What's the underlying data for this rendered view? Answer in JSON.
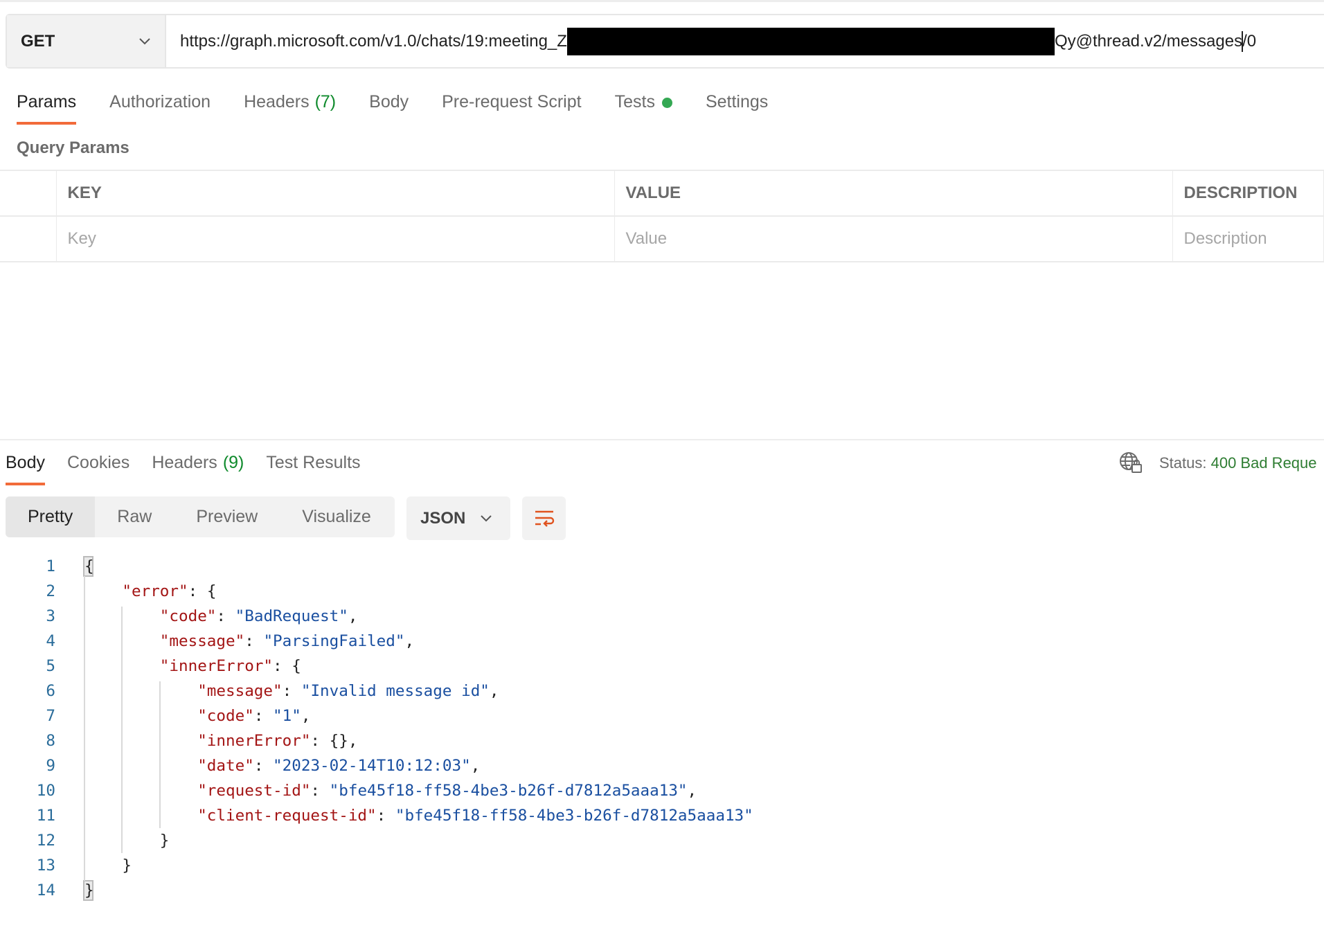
{
  "request": {
    "method": "GET",
    "url_prefix": "https://graph.microsoft.com/v1.0/chats/19:meeting_Z",
    "url_suffix_a": "Qy@thread.v2/messages",
    "url_suffix_b": "/0"
  },
  "request_tabs": [
    {
      "label": "Params",
      "active": true
    },
    {
      "label": "Authorization"
    },
    {
      "label": "Headers",
      "count": "(7)"
    },
    {
      "label": "Body"
    },
    {
      "label": "Pre-request Script"
    },
    {
      "label": "Tests",
      "dot": true
    },
    {
      "label": "Settings"
    }
  ],
  "query_params": {
    "title": "Query Params",
    "headers": [
      "KEY",
      "VALUE",
      "DESCRIPTION"
    ],
    "placeholders": [
      "Key",
      "Value",
      "Description"
    ]
  },
  "response_tabs": [
    {
      "label": "Body",
      "active": true
    },
    {
      "label": "Cookies"
    },
    {
      "label": "Headers",
      "count": "(9)"
    },
    {
      "label": "Test Results"
    }
  ],
  "status": {
    "label": "Status:",
    "value": "400 Bad Reque",
    "color": "#2e7d32"
  },
  "view_modes": [
    "Pretty",
    "Raw",
    "Preview",
    "Visualize"
  ],
  "format": "JSON",
  "accent": "#f26b3a",
  "code_lines": [
    [
      [
        "p",
        "{"
      ]
    ],
    [
      [
        "i",
        1
      ],
      [
        "k",
        "\"error\""
      ],
      [
        "p",
        ": {"
      ]
    ],
    [
      [
        "i",
        2
      ],
      [
        "k",
        "\"code\""
      ],
      [
        "p",
        ": "
      ],
      [
        "s",
        "\"BadRequest\""
      ],
      [
        "p",
        ","
      ]
    ],
    [
      [
        "i",
        2
      ],
      [
        "k",
        "\"message\""
      ],
      [
        "p",
        ": "
      ],
      [
        "s",
        "\"ParsingFailed\""
      ],
      [
        "p",
        ","
      ]
    ],
    [
      [
        "i",
        2
      ],
      [
        "k",
        "\"innerError\""
      ],
      [
        "p",
        ": {"
      ]
    ],
    [
      [
        "i",
        3
      ],
      [
        "k",
        "\"message\""
      ],
      [
        "p",
        ": "
      ],
      [
        "s",
        "\"Invalid message id\""
      ],
      [
        "p",
        ","
      ]
    ],
    [
      [
        "i",
        3
      ],
      [
        "k",
        "\"code\""
      ],
      [
        "p",
        ": "
      ],
      [
        "s",
        "\"1\""
      ],
      [
        "p",
        ","
      ]
    ],
    [
      [
        "i",
        3
      ],
      [
        "k",
        "\"innerError\""
      ],
      [
        "p",
        ": {},"
      ]
    ],
    [
      [
        "i",
        3
      ],
      [
        "k",
        "\"date\""
      ],
      [
        "p",
        ": "
      ],
      [
        "s",
        "\"2023-02-14T10:12:03\""
      ],
      [
        "p",
        ","
      ]
    ],
    [
      [
        "i",
        3
      ],
      [
        "k",
        "\"request-id\""
      ],
      [
        "p",
        ": "
      ],
      [
        "s",
        "\"bfe45f18-ff58-4be3-b26f-d7812a5aaa13\""
      ],
      [
        "p",
        ","
      ]
    ],
    [
      [
        "i",
        3
      ],
      [
        "k",
        "\"client-request-id\""
      ],
      [
        "p",
        ": "
      ],
      [
        "s",
        "\"bfe45f18-ff58-4be3-b26f-d7812a5aaa13\""
      ]
    ],
    [
      [
        "i",
        2
      ],
      [
        "p",
        "}"
      ]
    ],
    [
      [
        "i",
        1
      ],
      [
        "p",
        "}"
      ]
    ],
    [
      [
        "p",
        "}"
      ]
    ]
  ]
}
